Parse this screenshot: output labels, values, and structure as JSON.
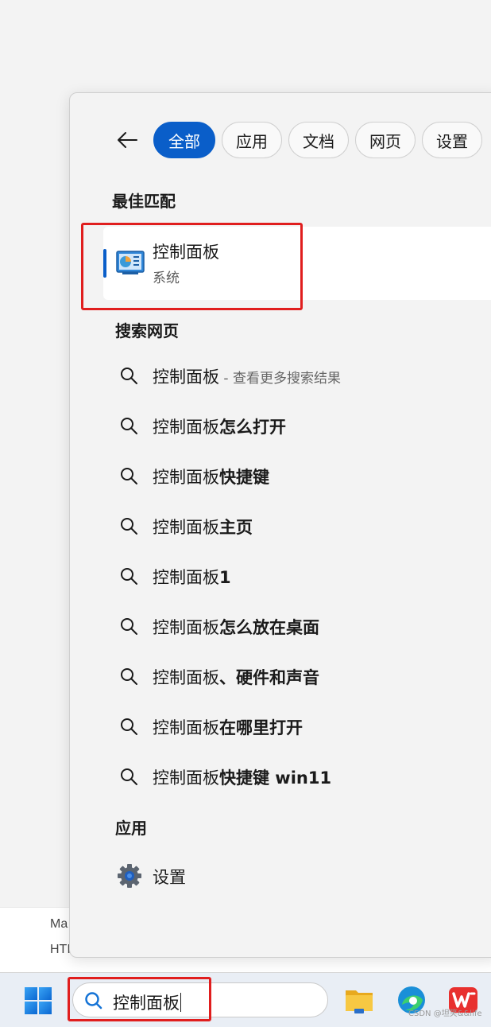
{
  "background": {
    "doc_line1": "Ma",
    "doc_line2": "HTI"
  },
  "tabs": [
    {
      "label": "全部",
      "active": true
    },
    {
      "label": "应用",
      "active": false
    },
    {
      "label": "文档",
      "active": false
    },
    {
      "label": "网页",
      "active": false
    },
    {
      "label": "设置",
      "active": false
    }
  ],
  "best_match": {
    "section_title": "最佳匹配",
    "title": "控制面板",
    "subtitle": "系统",
    "icon": "control-panel-icon"
  },
  "web_search": {
    "section_title": "搜索网页",
    "items": [
      {
        "prefix": "控制面板",
        "suffix": "",
        "hint": " - 查看更多搜索结果"
      },
      {
        "prefix": "控制面板",
        "suffix": "怎么打开",
        "hint": ""
      },
      {
        "prefix": "控制面板",
        "suffix": "快捷键",
        "hint": ""
      },
      {
        "prefix": "控制面板",
        "suffix": "主页",
        "hint": ""
      },
      {
        "prefix": "控制面板",
        "suffix": "1",
        "hint": ""
      },
      {
        "prefix": "控制面板",
        "suffix": "怎么放在桌面",
        "hint": ""
      },
      {
        "prefix": "控制面板",
        "suffix": "、硬件和声音",
        "hint": ""
      },
      {
        "prefix": "控制面板",
        "suffix": "在哪里打开",
        "hint": ""
      },
      {
        "prefix": "控制面板",
        "suffix": "快捷键 win11",
        "hint": ""
      }
    ]
  },
  "apps": {
    "section_title": "应用",
    "items": [
      {
        "label": "设置",
        "icon": "gear-icon"
      }
    ]
  },
  "taskbar": {
    "search_value": "控制面板",
    "watermark": "CSDN @坦笑&&life"
  },
  "colors": {
    "accent": "#0a5ec9",
    "highlight_box": "#e01e1e"
  }
}
